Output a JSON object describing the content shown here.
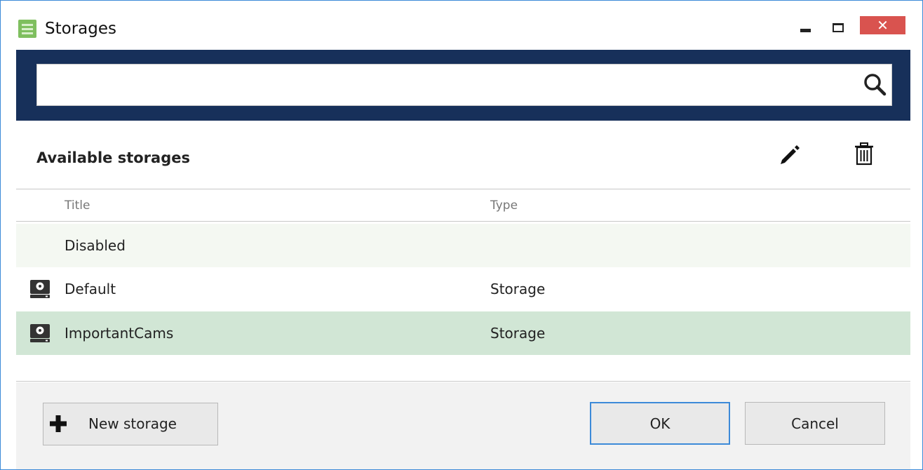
{
  "window": {
    "title": "Storages",
    "close_glyph": "✕"
  },
  "search": {
    "value": "",
    "placeholder": ""
  },
  "section": {
    "title": "Available storages"
  },
  "table": {
    "columns": [
      "Title",
      "Type"
    ],
    "rows": [
      {
        "title": "Disabled",
        "type": "",
        "icon": "none",
        "selected": false
      },
      {
        "title": "Default",
        "type": "Storage",
        "icon": "hard-drive-icon",
        "selected": false
      },
      {
        "title": "ImportantCams",
        "type": "Storage",
        "icon": "hard-drive-icon",
        "selected": true
      }
    ]
  },
  "buttons": {
    "new_storage": "New storage",
    "ok": "OK",
    "cancel": "Cancel"
  },
  "colors": {
    "search_band": "#17305a",
    "selected_row": "#d1e6d5",
    "disabled_row": "#f4f8f2",
    "close_button": "#d9534f",
    "accent_border": "#3c8ad8"
  }
}
